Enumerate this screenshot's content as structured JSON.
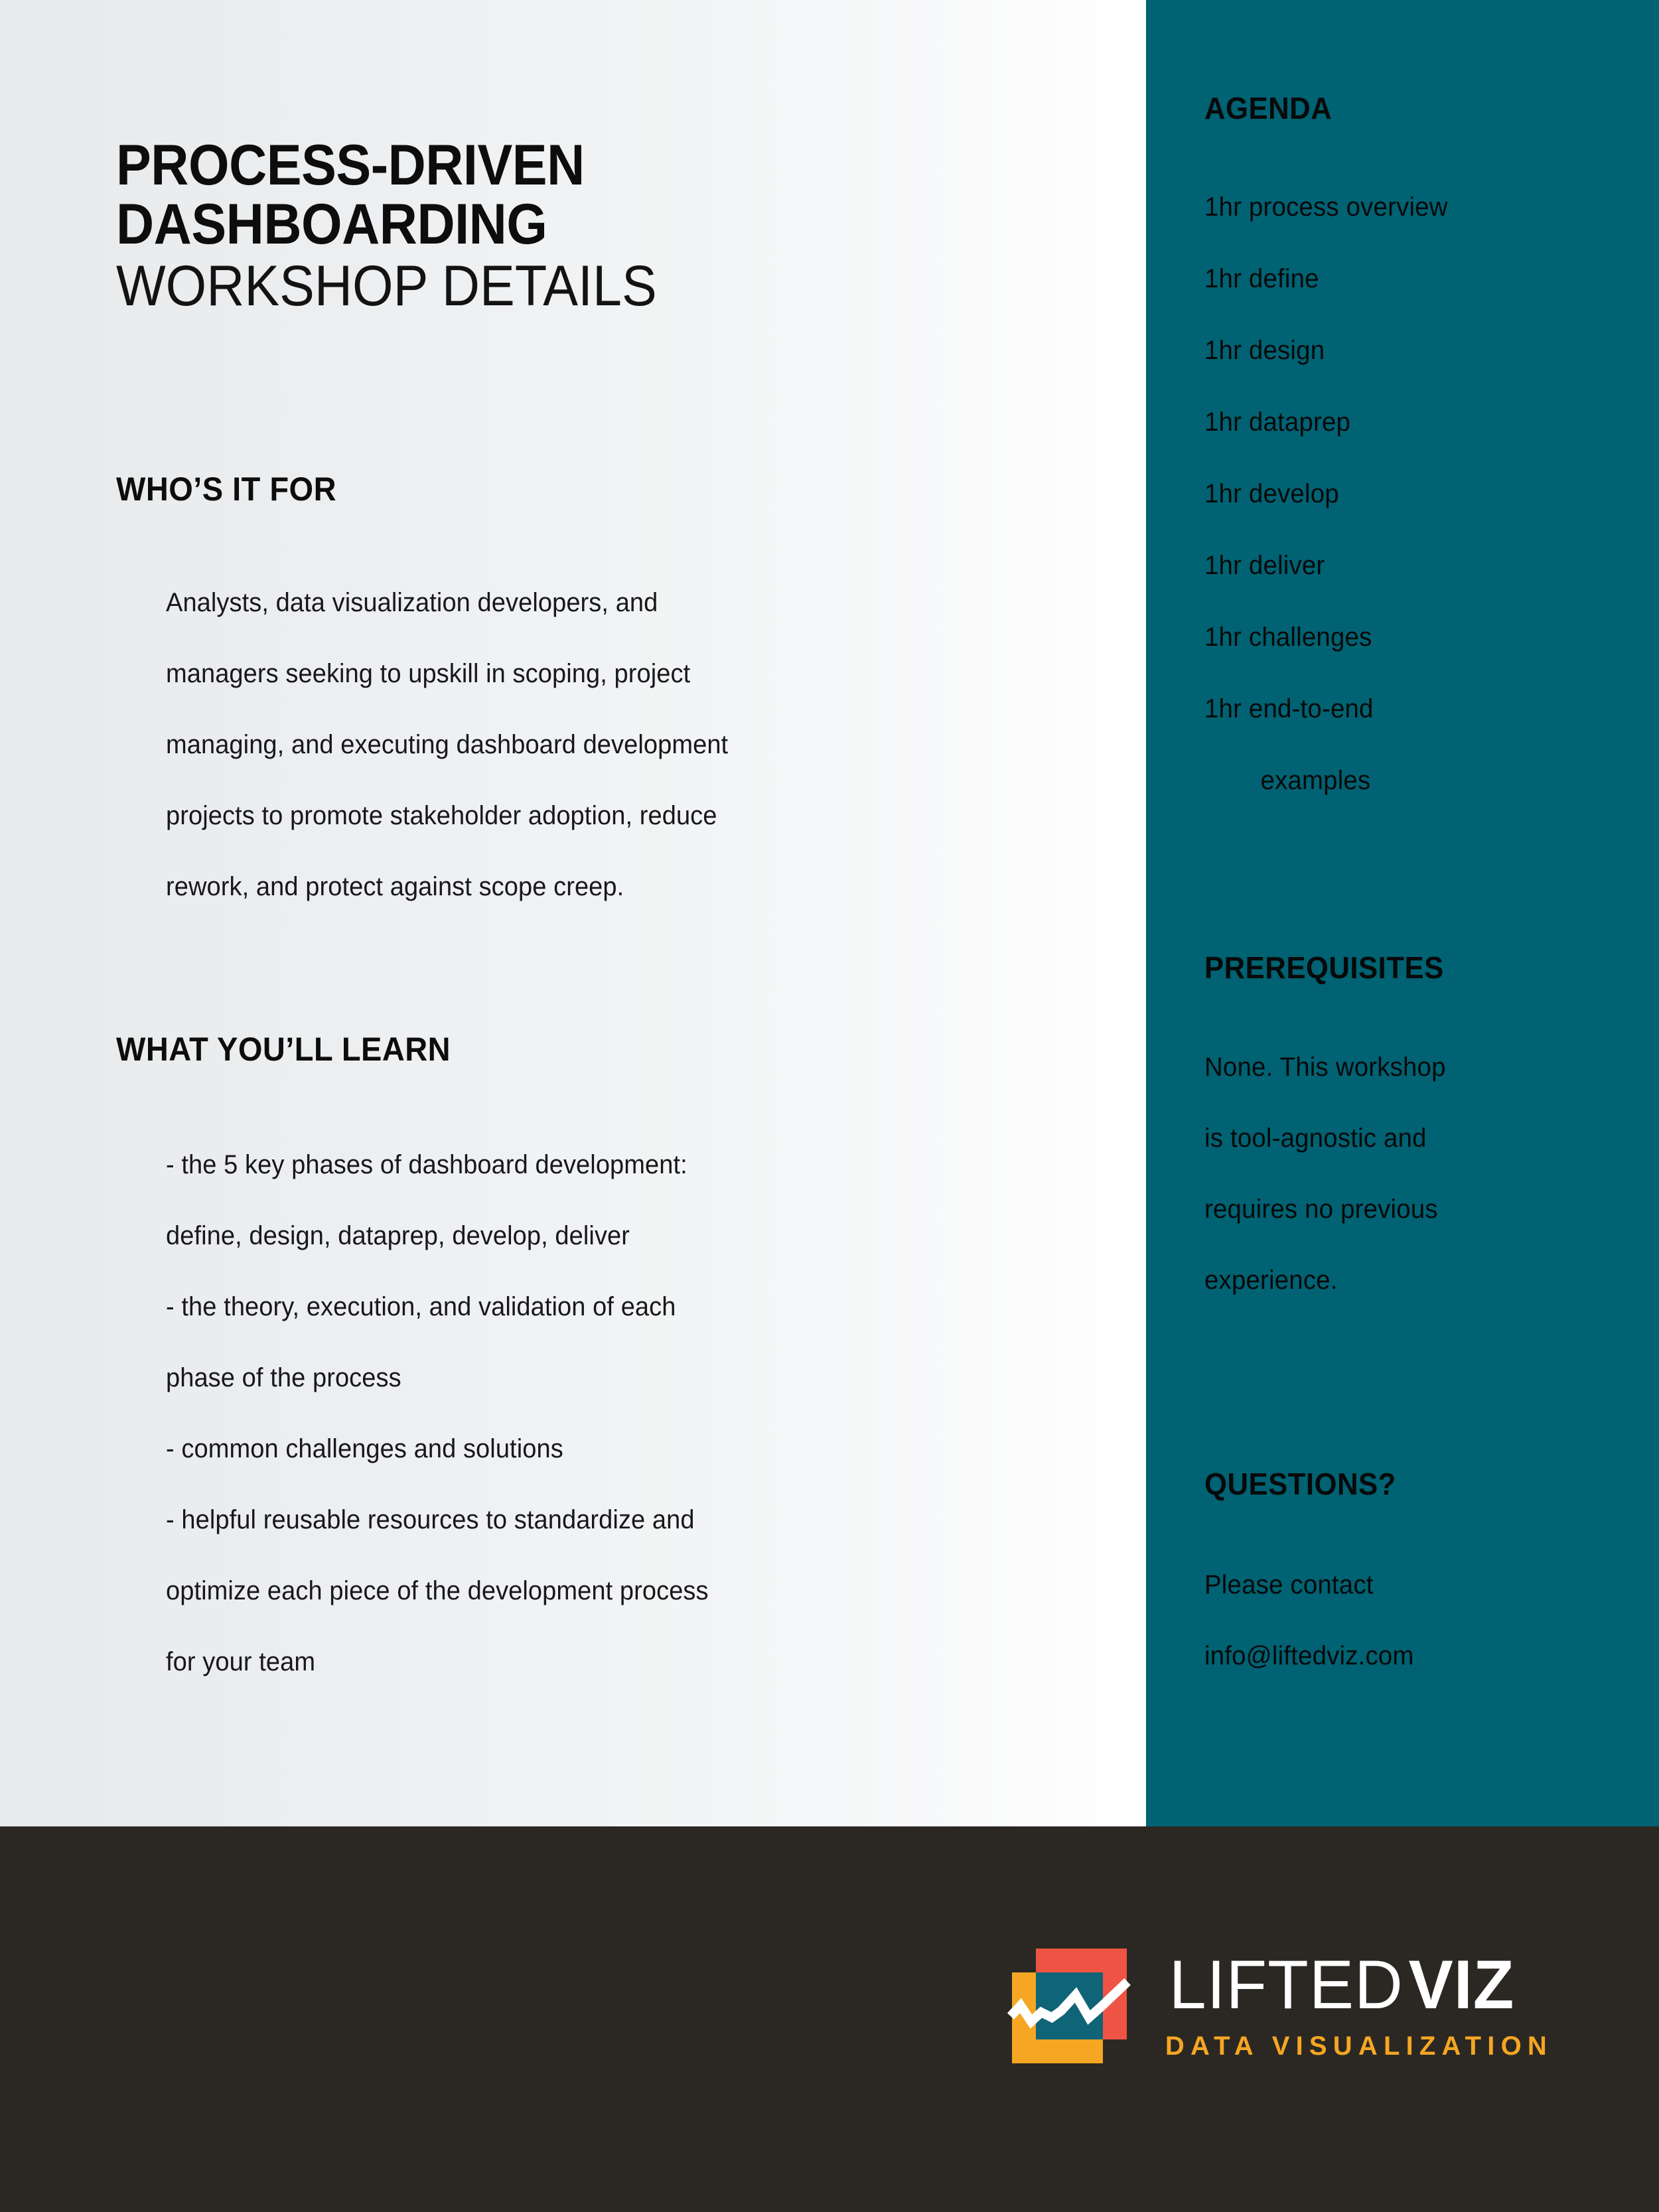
{
  "colors": {
    "sidebar_teal": "#006272",
    "footer_dark": "#2b2823",
    "logo_orange": "#f5a623",
    "logo_red": "#ef5343",
    "logo_yellow": "#f5a623",
    "logo_teal": "#0f6477",
    "text_dark": "#0d0d0d"
  },
  "title": {
    "line1": "PROCESS-DRIVEN",
    "line2": "DASHBOARDING",
    "line3": "WORKSHOP DETAILS"
  },
  "sections": {
    "who": {
      "heading": "WHO’S IT FOR",
      "lines": [
        "Analysts, data visualization developers, and",
        "managers seeking to upskill in scoping, project",
        "managing, and executing dashboard development",
        "projects to promote stakeholder adoption, reduce",
        "rework, and protect against scope creep."
      ]
    },
    "learn": {
      "heading": "WHAT YOU’LL LEARN",
      "lines": [
        "- the 5 key phases of dashboard development:",
        "define, design, dataprep, develop, deliver",
        "- the theory, execution, and validation of each",
        "phase of the process",
        "- common challenges and solutions",
        "- helpful reusable resources to standardize and",
        "optimize each piece of the development process",
        "for your team"
      ]
    }
  },
  "sidebar": {
    "agenda": {
      "heading": "AGENDA",
      "items": [
        {
          "text": "1hr process overview",
          "indented": false
        },
        {
          "text": "1hr define",
          "indented": false
        },
        {
          "text": "1hr design",
          "indented": false
        },
        {
          "text": "1hr dataprep",
          "indented": false
        },
        {
          "text": "1hr develop",
          "indented": false
        },
        {
          "text": "1hr deliver",
          "indented": false
        },
        {
          "text": "1hr challenges",
          "indented": false
        },
        {
          "text": "1hr end-to-end",
          "indented": false
        },
        {
          "text": "examples",
          "indented": true
        }
      ]
    },
    "prerequisites": {
      "heading": "PREREQUISITES",
      "lines": [
        "None. This workshop",
        "is tool-agnostic and",
        "requires no previous",
        "experience."
      ]
    },
    "questions": {
      "heading": "QUESTIONS?",
      "lines": [
        "Please contact",
        "info@liftedviz.com"
      ]
    }
  },
  "footer": {
    "logo": {
      "name_light": "LIFTED",
      "name_bold": "VIZ",
      "tagline": "DATA VISUALIZATION"
    }
  }
}
